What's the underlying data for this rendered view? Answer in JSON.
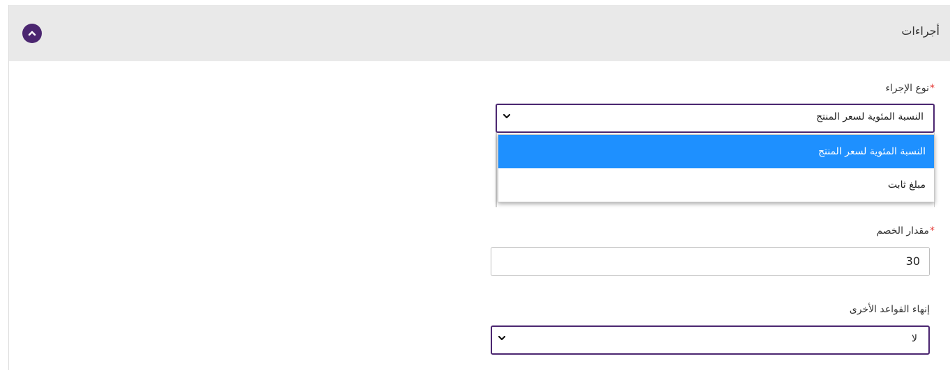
{
  "panel": {
    "title": "أجراءات",
    "collapse_icon": "chevron-up-icon",
    "accent_color": "#4b2670"
  },
  "action_type": {
    "label": "نوع الإجراء",
    "required_mark": "*",
    "selected": "النسبة المئوية لسعر المنتج",
    "options": [
      "النسبة المئوية لسعر المنتج",
      "مبلغ ثابت"
    ],
    "highlight_color": "#1e90ff"
  },
  "discount_amount": {
    "label": "مقدار الخصم",
    "required_mark": "*",
    "value": "30"
  },
  "end_other_rules": {
    "label": "إنهاء القواعد الأخرى",
    "selected": "لا"
  }
}
